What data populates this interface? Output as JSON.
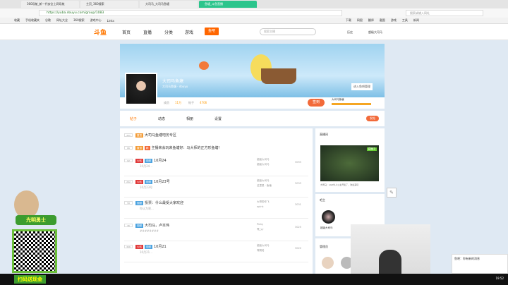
{
  "browser": {
    "tabs": [
      "360导航_新一代安全上网导航",
      "主页_360搜索",
      "大司马_大司马鱼塘",
      "鱼塘_斗鱼直播"
    ],
    "url": "https://yuba.douyu.com/group/1083",
    "search_placeholder": "搜索或输入网址",
    "bookmarks": [
      "收藏",
      "手机收藏夹",
      "谷歌",
      "网址大全",
      "360搜索",
      "游戏中心",
      "Links"
    ],
    "right_bookmarks": [
      "下载",
      "网银",
      "翻译",
      "截图",
      "游戏",
      "工具",
      "新闻"
    ]
  },
  "site": {
    "logo": "斗鱼",
    "nav": [
      "首页",
      "直播",
      "分类",
      "游戏"
    ],
    "live_btn": "鱼吧",
    "search_placeholder": "搜索主播",
    "history": "历史",
    "user": "超级大司马"
  },
  "group": {
    "name": "大司马鱼塘",
    "desc": "大司马鱼塘 · douyu",
    "members_label": "成员",
    "members": "11万",
    "posts_label": "帖子",
    "posts": "4706",
    "join_btn": "签到",
    "level": "大司马鱼塘",
    "manage_btn": "进入鱼吧管理"
  },
  "page_tabs": [
    "帖子",
    "动态",
    "相册",
    "设置"
  ],
  "post_btn": "发帖",
  "posts": [
    {
      "num": "301",
      "tags": [
        "置顶"
      ],
      "title": "大司马鱼塘吧务专区",
      "sub": "",
      "author": "",
      "reply": "",
      "count": ""
    },
    {
      "num": "66",
      "tags": [
        "置顶",
        "精"
      ],
      "title": "主播来会玩来鱼塘好：马大师的正方形鱼塘！",
      "sub": "",
      "author": "",
      "reply": "",
      "count": ""
    },
    {
      "num": "92",
      "tags": [
        "火帖",
        "视频"
      ],
      "title": "10月24",
      "sub": "10月24...",
      "author": "超级大司马",
      "reply": "超级大司马",
      "count": "3093"
    },
    {
      "num": "262",
      "tags": [
        "火帖",
        "视频"
      ],
      "title": "10月23号",
      "sub": "10月23号",
      "author": "超级大司马",
      "reply": "这里是 · 鱼塘",
      "count": "3033"
    },
    {
      "num": "58",
      "tags": [
        "视频"
      ],
      "title": "投票：什么最受大家欢迎",
      "sub": "你认为呢...",
      "author": "大哥带你飞",
      "reply": "apink",
      "count": "3031"
    },
    {
      "num": "36",
      "tags": [
        "视频"
      ],
      "title": "大司马，卢本伟",
      "sub": "########",
      "author": "Pinky",
      "reply": "嘿_yy",
      "count": "3025"
    },
    {
      "num": "306",
      "tags": [
        "火帖",
        "视频"
      ],
      "title": "10月21",
      "sub": "10月21...",
      "author": "超级大司马",
      "reply": "嘿嘿哈",
      "count": "3020"
    }
  ],
  "side": {
    "live_title": "直播间",
    "live_badge": "直播中",
    "live_caption": "大司马：LGD牛人公主开麦了，欢迎来玩",
    "owner_title": "吧主",
    "owner_name": "超级大司马",
    "admins_title": "管理员"
  },
  "overlay": {
    "game": "光明勇士",
    "promo": "扫码送现金"
  },
  "notification": "鱼吧：你有新的消息",
  "clock": "19:52"
}
